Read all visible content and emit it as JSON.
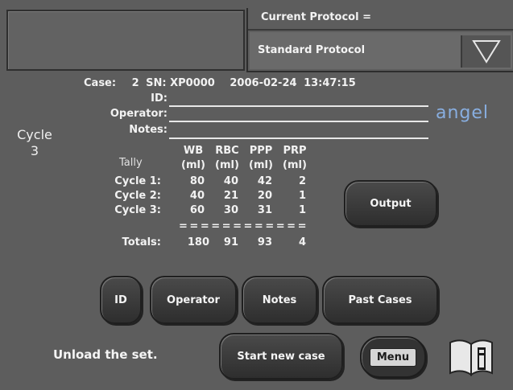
{
  "protocol": {
    "title": "Current Protocol =",
    "selected": "Standard Protocol"
  },
  "cycle": {
    "label": "Cycle",
    "number": "3"
  },
  "case_info": {
    "case_label": "Case:",
    "case_value": "2",
    "sn_label": "SN:",
    "sn_value": "XP0000",
    "date": "2006-02-24",
    "time": "13:47:15",
    "id_label": "ID:",
    "operator_label": "Operator:",
    "notes_label": "Notes:"
  },
  "logo": {
    "text": "angel",
    "color": "#88aee0"
  },
  "tally": {
    "caption": "Tally",
    "columns": [
      {
        "name": "WB",
        "unit": "(ml)"
      },
      {
        "name": "RBC",
        "unit": "(ml)"
      },
      {
        "name": "PPP",
        "unit": "(ml)"
      },
      {
        "name": "PRP",
        "unit": "(ml)"
      }
    ],
    "rows": [
      {
        "label": "Cycle 1:",
        "values": [
          "80",
          "40",
          "42",
          "2"
        ]
      },
      {
        "label": "Cycle 2:",
        "values": [
          "40",
          "21",
          "20",
          "1"
        ]
      },
      {
        "label": "Cycle 3:",
        "values": [
          "60",
          "30",
          "31",
          "1"
        ]
      }
    ],
    "separator": "= = = = = = = = = = = =",
    "totals": {
      "label": "Totals:",
      "values": [
        "180",
        "91",
        "93",
        "4"
      ]
    }
  },
  "buttons": {
    "output": "Output",
    "id": "ID",
    "operator": "Operator",
    "notes": "Notes",
    "past_cases": "Past Cases",
    "start_new_case": "Start new case",
    "menu": "Menu"
  },
  "status": {
    "message": "Unload the set."
  }
}
